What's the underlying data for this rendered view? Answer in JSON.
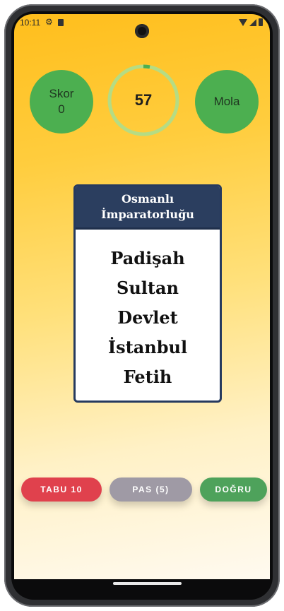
{
  "status_bar": {
    "time": "10:11",
    "icons": [
      "gear-icon",
      "sd-card-icon",
      "wifi-icon",
      "signal-icon",
      "battery-icon"
    ]
  },
  "header": {
    "score_label": "Skor",
    "score_value": "0",
    "timer_value": "57",
    "timer_progress_fraction": 0.03,
    "break_label": "Mola"
  },
  "card": {
    "title": "Osmanlı İmparatorluğu",
    "taboo_words": [
      "Padişah",
      "Sultan",
      "Devlet",
      "İstanbul",
      "Fetih"
    ]
  },
  "actions": {
    "taboo_label": "TABU 10",
    "pass_label": "PAS (5)",
    "correct_label": "DOĞRU"
  },
  "colors": {
    "green_circle": "#4caf50",
    "card_header": "#2b3e5f",
    "taboo_button": "#e0414d",
    "pass_button": "#9f9aa5",
    "correct_button": "#4ea25b",
    "timer_track": "#b5dc84",
    "timer_arc": "#4caf50"
  }
}
